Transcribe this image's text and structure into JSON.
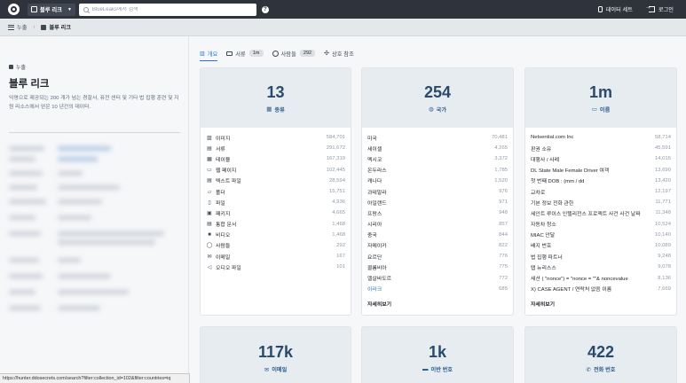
{
  "topbar": {
    "collection_label": "블루 리크",
    "search_placeholder": "BlueLeaks에서 검색",
    "help": "?",
    "datasets_label": "데이터 세트",
    "login_label": "로그인"
  },
  "breadcrumb": {
    "root": "누출",
    "current": "블루 리크"
  },
  "sidebar": {
    "kicker": "누출",
    "title": "블루 리크",
    "description": "익명으로 제공되는 200 개가 넘는 경찰서, 퓨전 센터 및 기타 법 집행 훈련 및 지원 리소스에서 얻은 10 년간의 데이터."
  },
  "tabs": [
    {
      "label": "개요",
      "badge": ""
    },
    {
      "label": "서류",
      "badge": "1m"
    },
    {
      "label": "사람들",
      "badge": "292"
    },
    {
      "label": "상호 참조",
      "badge": ""
    }
  ],
  "cards": {
    "types": {
      "number": "13",
      "label": "종류",
      "rows": [
        {
          "icon": "image-icon",
          "glyph": "▨",
          "label": "이미지",
          "count": "584,701"
        },
        {
          "icon": "document-icon",
          "glyph": "▤",
          "label": "서류",
          "count": "291,672"
        },
        {
          "icon": "table-icon",
          "glyph": "▦",
          "label": "테이블",
          "count": "167,319"
        },
        {
          "icon": "webpage-icon",
          "glyph": "▭",
          "label": "웹 페이지",
          "count": "102,445"
        },
        {
          "icon": "text-file-icon",
          "glyph": "▤",
          "label": "텍스트 파일",
          "count": "28,594"
        },
        {
          "icon": "folder-icon",
          "glyph": "▱",
          "label": "폴더",
          "count": "15,751"
        },
        {
          "icon": "file-icon",
          "glyph": "▯",
          "label": "파일",
          "count": "4,936"
        },
        {
          "icon": "package-icon",
          "glyph": "▣",
          "label": "패키지",
          "count": "4,665"
        },
        {
          "icon": "email-document-icon",
          "glyph": "▤",
          "label": "통합 문서",
          "count": "1,468"
        },
        {
          "icon": "video-icon",
          "glyph": "■",
          "label": "비디오",
          "count": "1,468"
        },
        {
          "icon": "person-icon",
          "glyph": "◯",
          "label": "사람들",
          "count": "292"
        },
        {
          "icon": "email-icon",
          "glyph": "✉",
          "label": "이메일",
          "count": "167"
        },
        {
          "icon": "audio-icon",
          "glyph": "◁",
          "label": "오디오 파일",
          "count": "101"
        }
      ]
    },
    "countries": {
      "number": "254",
      "label": "국가",
      "rows": [
        {
          "label": "미국",
          "count": "70,481",
          "link": false
        },
        {
          "label": "세이셸",
          "count": "4,265",
          "link": false
        },
        {
          "label": "멕시코",
          "count": "3,372",
          "link": false
        },
        {
          "label": "온두라스",
          "count": "1,785",
          "link": false
        },
        {
          "label": "캐나다",
          "count": "1,520",
          "link": false
        },
        {
          "label": "과테말라",
          "count": "976",
          "link": false
        },
        {
          "label": "아일랜드",
          "count": "971",
          "link": false
        },
        {
          "label": "프랑스",
          "count": "948",
          "link": false
        },
        {
          "label": "시리아",
          "count": "857",
          "link": false
        },
        {
          "label": "중국",
          "count": "844",
          "link": false
        },
        {
          "label": "자메이카",
          "count": "822",
          "link": false
        },
        {
          "label": "요르단",
          "count": "776",
          "link": false
        },
        {
          "label": "콜롬비아",
          "count": "775",
          "link": false
        },
        {
          "label": "엘살바도르",
          "count": "772",
          "link": false
        },
        {
          "label": "이라크",
          "count": "685",
          "link": true
        }
      ],
      "more": "자세히보기"
    },
    "names": {
      "number": "1m",
      "label": "이름",
      "rows": [
        {
          "label": "Netsential.com Inc",
          "count": "58,714"
        },
        {
          "label": "판권 소유",
          "count": "45,591"
        },
        {
          "label": "대행사 / 사례",
          "count": "14,015"
        },
        {
          "label": "DL State Male Female Driver 여객",
          "count": "13,690"
        },
        {
          "label": "첫 번째 DOB : (mm / dd",
          "count": "13,420"
        },
        {
          "label": "교차로",
          "count": "12,197"
        },
        {
          "label": "기본 정보 전화 관한",
          "count": "11,771"
        },
        {
          "label": "세인트 루이스 인텔리전스 프로젝트 사건 사건 날짜",
          "count": "11,348"
        },
        {
          "label": "자동차 청소",
          "count": "10,524"
        },
        {
          "label": "MIAC 안달",
          "count": "10,140"
        },
        {
          "label": "배지 번호",
          "count": "10,089"
        },
        {
          "label": "법 집행 파트너",
          "count": "9,248"
        },
        {
          "label": "탭 뉴리스스",
          "count": "9,078"
        },
        {
          "label": "세션 ( \"nonce\") = \"nonce = \"\"& noncevalue",
          "count": "8,136"
        },
        {
          "label": "X) CASE AGENT / 연락처 없음 이름",
          "count": "7,669"
        }
      ],
      "more": "자세히보기"
    },
    "emails": {
      "number": "117k",
      "label": "이메일"
    },
    "ibans": {
      "number": "1k",
      "label": "이반 번호"
    },
    "phones": {
      "number": "422",
      "label": "전화 번호"
    }
  },
  "status_url": "https://hunter.ddosecrets.com/search?filter:collection_id=102&filter:countries=iq"
}
